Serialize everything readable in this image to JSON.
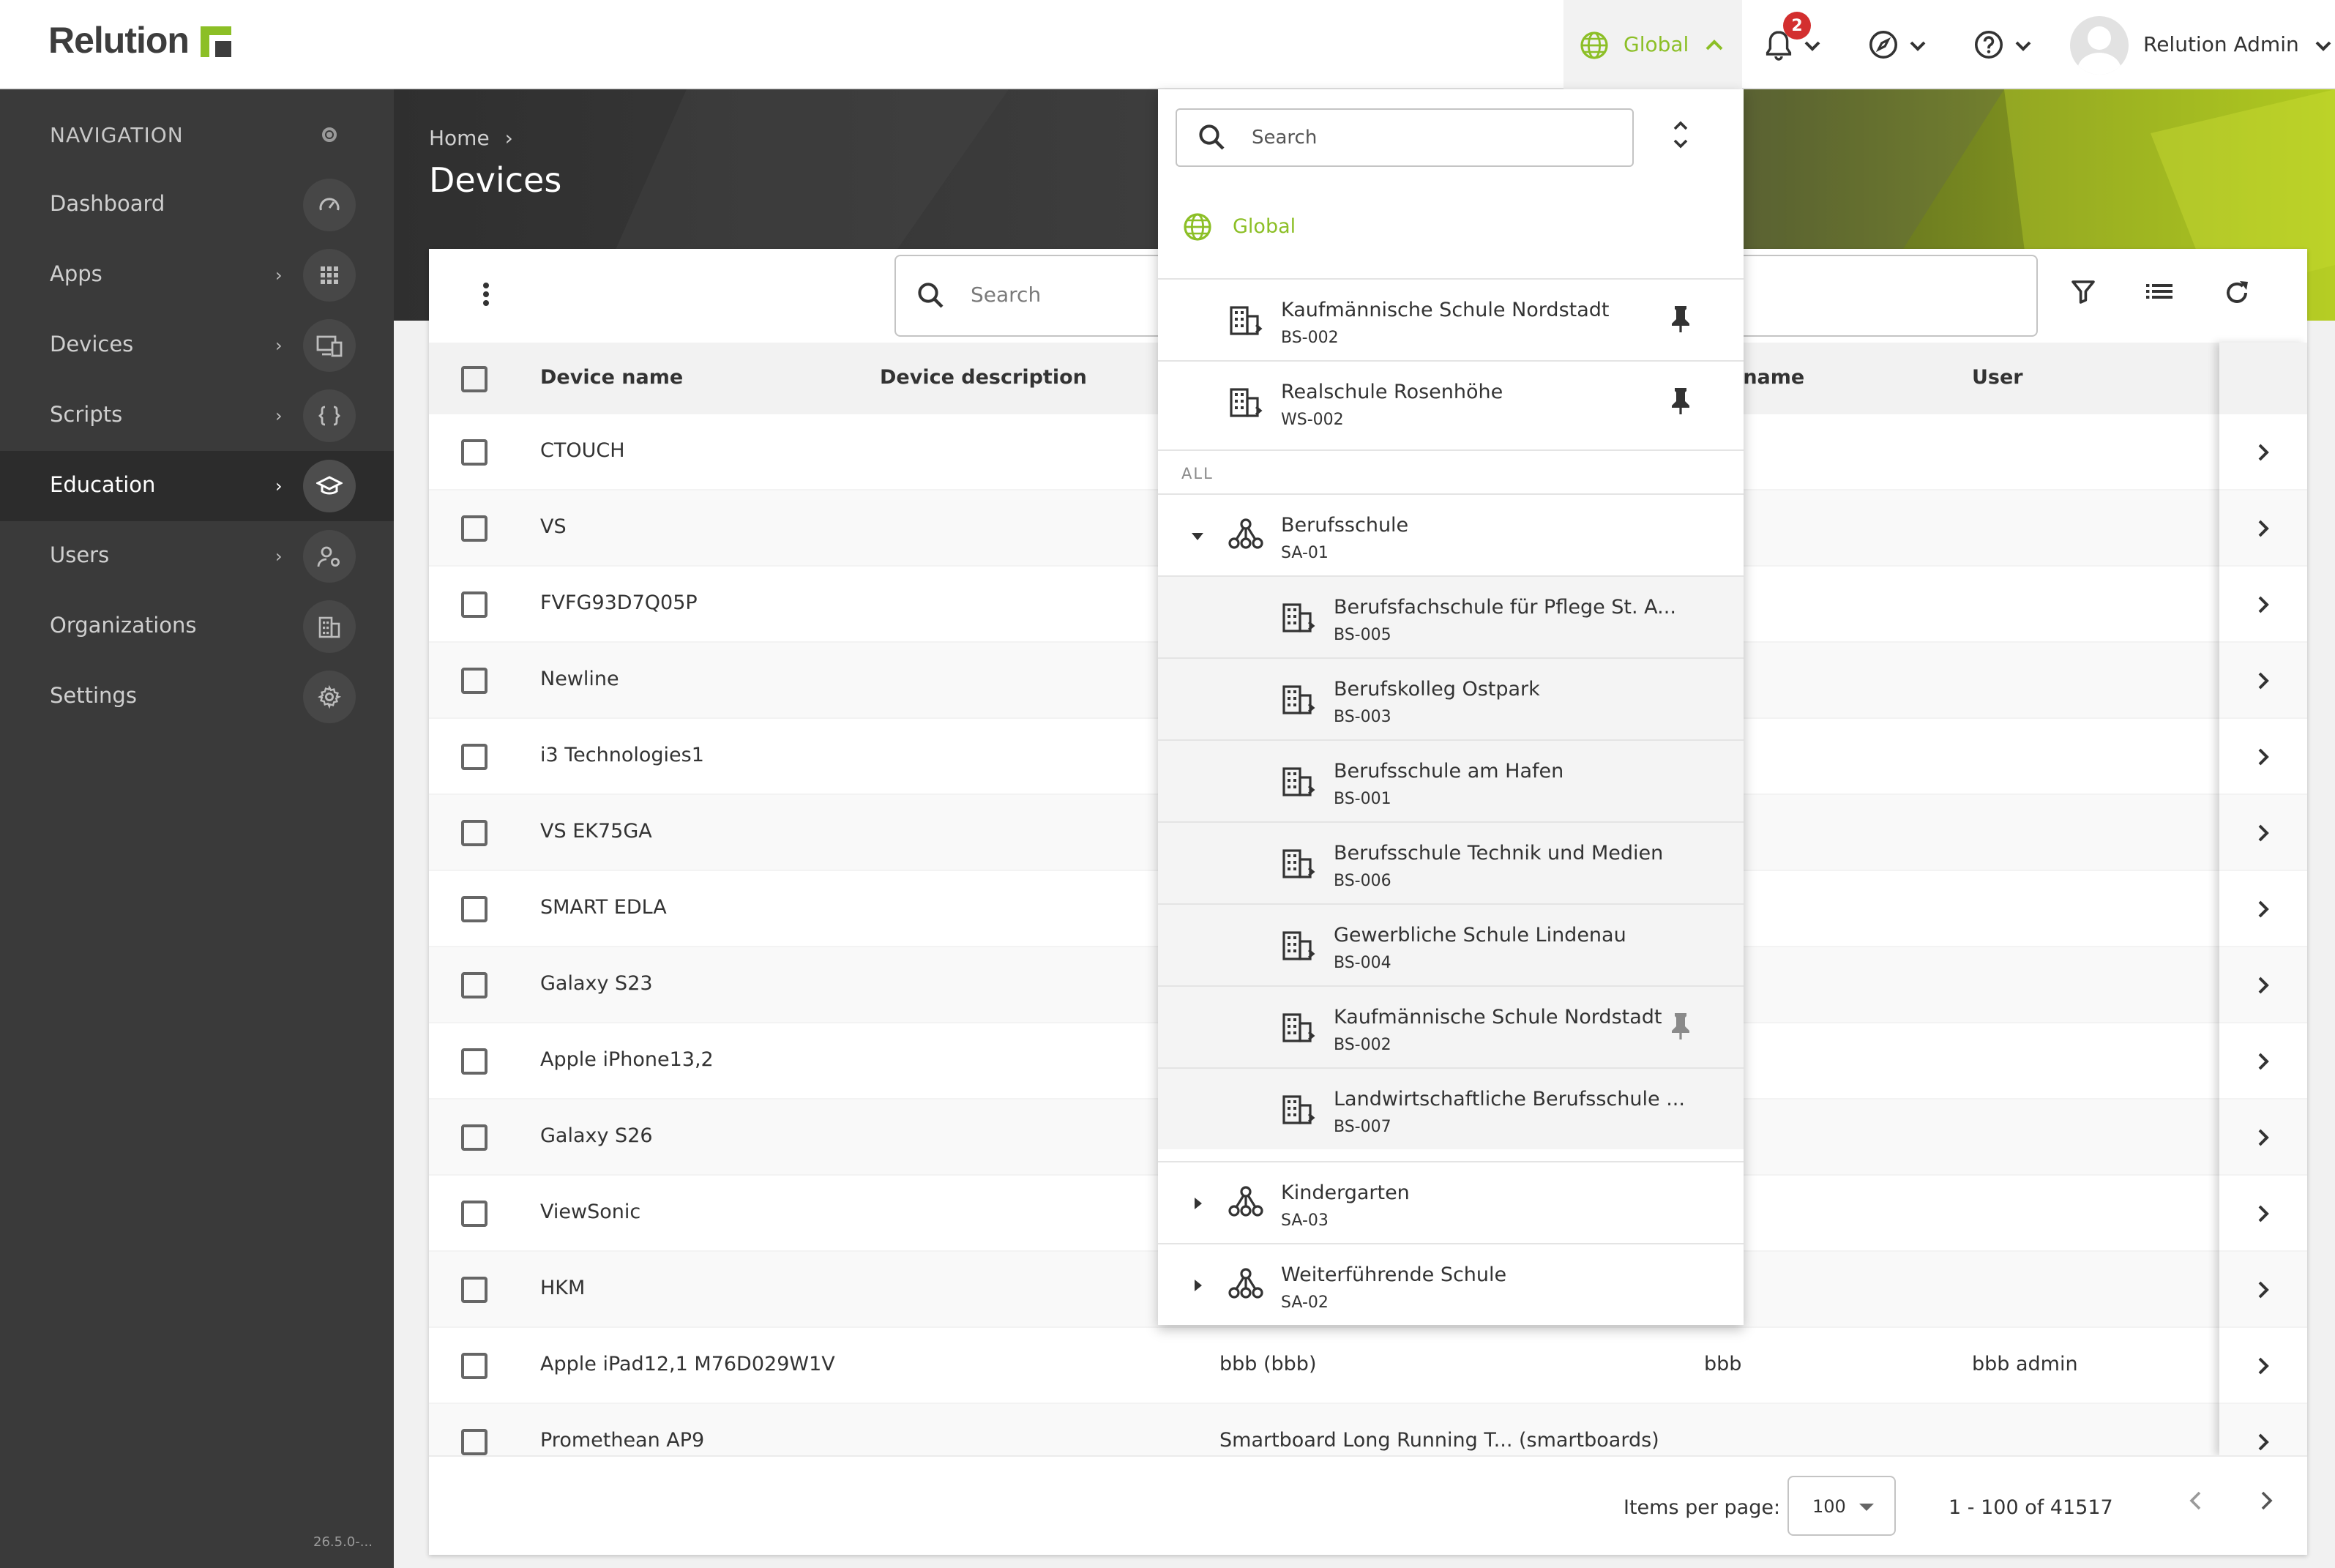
{
  "app": {
    "logo_text": "Relution"
  },
  "topbar": {
    "context_label": "Global",
    "notification_count": "2",
    "user_name": "Relution Admin"
  },
  "sidebar": {
    "heading": "NAVIGATION",
    "items": [
      {
        "label": "Dashboard",
        "icon": "speedometer-icon"
      },
      {
        "label": "Apps",
        "icon": "grid-icon"
      },
      {
        "label": "Devices",
        "icon": "devices-icon"
      },
      {
        "label": "Scripts",
        "icon": "braces-icon"
      },
      {
        "label": "Education",
        "icon": "graduation-cap-icon"
      },
      {
        "label": "Users",
        "icon": "users-icon"
      },
      {
        "label": "Organizations",
        "icon": "building-icon"
      },
      {
        "label": "Settings",
        "icon": "gear-icon"
      }
    ],
    "version": "26.5.0-..."
  },
  "header": {
    "breadcrumb": "Home",
    "title": "Devices"
  },
  "table": {
    "search_placeholder": "Search",
    "columns": [
      "Device name",
      "Device description",
      "rname",
      "User"
    ],
    "rows": [
      {
        "name": "CTOUCH",
        "description": "",
        "username": "",
        "user": ""
      },
      {
        "name": "VS",
        "description": "",
        "username": "",
        "user": ""
      },
      {
        "name": "FVFG93D7Q05P",
        "description": "",
        "username": "",
        "user": ""
      },
      {
        "name": "Newline",
        "description": "",
        "username": "",
        "user": ""
      },
      {
        "name": "i3 Technologies1",
        "description": "",
        "username": "",
        "user": ""
      },
      {
        "name": "VS EK75GA",
        "description": "",
        "username": "",
        "user": ""
      },
      {
        "name": "SMART EDLA",
        "description": "",
        "username": "",
        "user": ""
      },
      {
        "name": "Galaxy S23",
        "description": "",
        "username": "",
        "user": ""
      },
      {
        "name": "Apple iPhone13,2",
        "description": "",
        "username": "",
        "user": ""
      },
      {
        "name": "Galaxy S26",
        "description": "",
        "username": "",
        "user": ""
      },
      {
        "name": "ViewSonic",
        "description": "",
        "username": "",
        "user": ""
      },
      {
        "name": "HKM",
        "description": "",
        "username": "",
        "user": ""
      },
      {
        "name": "Apple iPad12,1 M76D029W1V",
        "description": "bbb (bbb)",
        "username": "bbb",
        "user": "bbb admin"
      },
      {
        "name": "Promethean AP9",
        "description": "Smartboard Long Running T... (smartboards)",
        "username": "",
        "user": ""
      }
    ],
    "pagination": {
      "items_per_page_label": "Items per page:",
      "items_per_page": "100",
      "range": "1 - 100 of 41517"
    }
  },
  "dropdown": {
    "search_placeholder": "Search",
    "global_label": "Global",
    "pinned": [
      {
        "name": "Kaufmännische Schule Nordstadt",
        "code": "BS-002"
      },
      {
        "name": "Realschule Rosenhöhe",
        "code": "WS-002"
      }
    ],
    "all_label": "ALL",
    "groups": [
      {
        "name": "Berufsschule",
        "code": "SA-01",
        "expanded": true,
        "children": [
          {
            "name": "Berufsfachschule für Pflege St. A...",
            "code": "BS-005"
          },
          {
            "name": "Berufskolleg Ostpark",
            "code": "BS-003"
          },
          {
            "name": "Berufsschule am Hafen",
            "code": "BS-001"
          },
          {
            "name": "Berufsschule Technik und Medien",
            "code": "BS-006"
          },
          {
            "name": "Gewerbliche Schule Lindenau",
            "code": "BS-004"
          },
          {
            "name": "Kaufmännische Schule Nordstadt",
            "code": "BS-002"
          },
          {
            "name": "Landwirtschaftliche Berufsschule ...",
            "code": "BS-007"
          }
        ]
      },
      {
        "name": "Kindergarten",
        "code": "SA-03",
        "expanded": false
      },
      {
        "name": "Weiterführende Schule",
        "code": "SA-02",
        "expanded": false
      }
    ]
  },
  "colors": {
    "accent": "#8cbf26",
    "sidebar": "#3a3a3a",
    "badge": "#d32f2f"
  }
}
